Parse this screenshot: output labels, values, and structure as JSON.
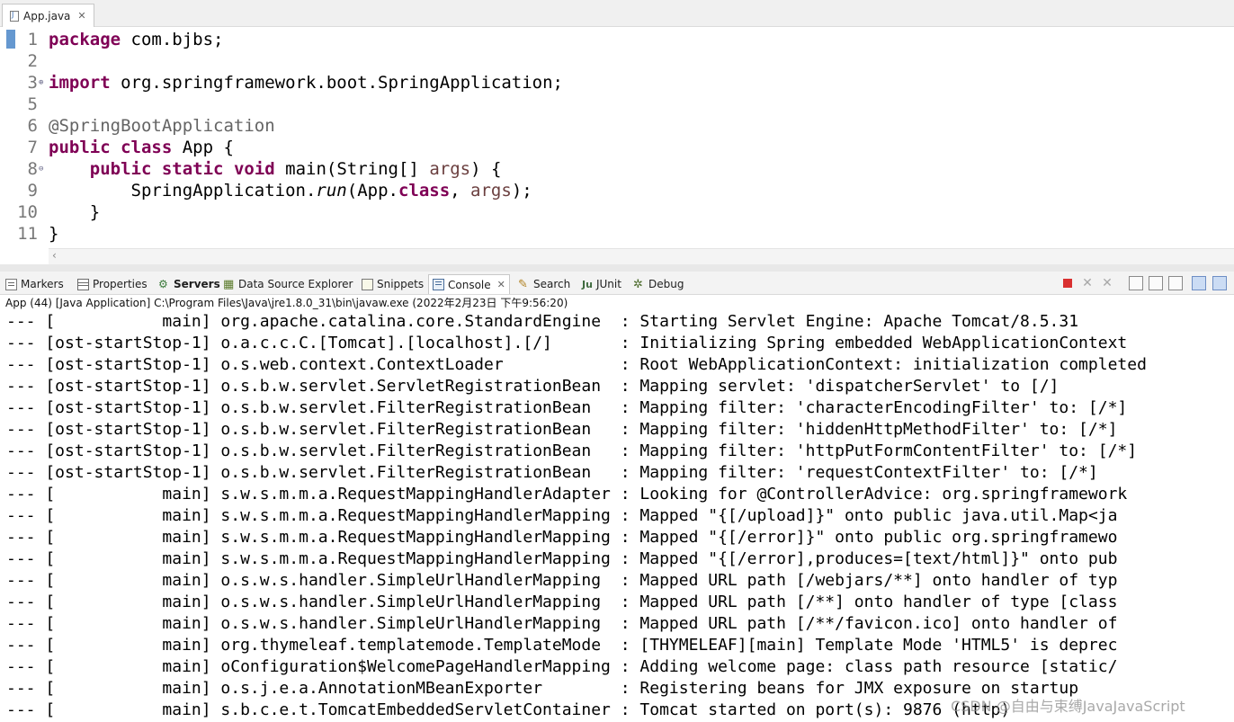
{
  "editor": {
    "tab_title": "App.java",
    "line_numbers": [
      "1",
      "2",
      "3",
      "5",
      "6",
      "7",
      "8",
      "9",
      "10",
      "11"
    ],
    "code_lines": [
      [
        {
          "t": "package",
          "c": "kw"
        },
        {
          "t": " com.bjbs;"
        }
      ],
      [],
      [
        {
          "t": "import",
          "c": "kw"
        },
        {
          "t": " org.springframework.boot.SpringApplication;"
        }
      ],
      [],
      [
        {
          "t": "@SpringBootApplication",
          "c": "ann"
        }
      ],
      [
        {
          "t": "public",
          "c": "kw"
        },
        {
          "t": " "
        },
        {
          "t": "class",
          "c": "kw"
        },
        {
          "t": " App {"
        }
      ],
      [
        {
          "t": "    "
        },
        {
          "t": "public",
          "c": "kw"
        },
        {
          "t": " "
        },
        {
          "t": "static",
          "c": "kw"
        },
        {
          "t": " "
        },
        {
          "t": "void",
          "c": "kw"
        },
        {
          "t": " main(String[] "
        },
        {
          "t": "args",
          "c": "var"
        },
        {
          "t": ") {"
        }
      ],
      [
        {
          "t": "        SpringApplication."
        },
        {
          "t": "run",
          "c": "it"
        },
        {
          "t": "(App."
        },
        {
          "t": "class",
          "c": "kw"
        },
        {
          "t": ", "
        },
        {
          "t": "args",
          "c": "var"
        },
        {
          "t": ");"
        }
      ],
      [
        {
          "t": "    }"
        }
      ],
      [
        {
          "t": "}"
        }
      ]
    ]
  },
  "views": {
    "tabs": [
      "Markers",
      "Properties",
      "Servers",
      "Data Source Explorer",
      "Snippets",
      "Console",
      "Search",
      "JUnit",
      "Debug"
    ],
    "active_tab": "Console",
    "toolbar_icons": [
      "terminate-icon",
      "remove-launch-icon",
      "remove-all-terminated-icon",
      "clear-console-icon",
      "scroll-lock-icon",
      "word-wrap-icon",
      "show-console-on-output-icon",
      "show-console-on-error-icon"
    ]
  },
  "console": {
    "header": "App (44) [Java Application] C:\\Program Files\\Java\\jre1.8.0_31\\bin\\javaw.exe (2022年2月23日 下午9:56:20)",
    "lines": [
      "--- [           main] org.apache.catalina.core.StandardEngine  : Starting Servlet Engine: Apache Tomcat/8.5.31",
      "--- [ost-startStop-1] o.a.c.c.C.[Tomcat].[localhost].[/]       : Initializing Spring embedded WebApplicationContext",
      "--- [ost-startStop-1] o.s.web.context.ContextLoader            : Root WebApplicationContext: initialization completed",
      "--- [ost-startStop-1] o.s.b.w.servlet.ServletRegistrationBean  : Mapping servlet: 'dispatcherServlet' to [/]",
      "--- [ost-startStop-1] o.s.b.w.servlet.FilterRegistrationBean   : Mapping filter: 'characterEncodingFilter' to: [/*]",
      "--- [ost-startStop-1] o.s.b.w.servlet.FilterRegistrationBean   : Mapping filter: 'hiddenHttpMethodFilter' to: [/*]",
      "--- [ost-startStop-1] o.s.b.w.servlet.FilterRegistrationBean   : Mapping filter: 'httpPutFormContentFilter' to: [/*]",
      "--- [ost-startStop-1] o.s.b.w.servlet.FilterRegistrationBean   : Mapping filter: 'requestContextFilter' to: [/*]",
      "--- [           main] s.w.s.m.m.a.RequestMappingHandlerAdapter : Looking for @ControllerAdvice: org.springframework",
      "--- [           main] s.w.s.m.m.a.RequestMappingHandlerMapping : Mapped \"{[/upload]}\" onto public java.util.Map<ja",
      "--- [           main] s.w.s.m.m.a.RequestMappingHandlerMapping : Mapped \"{[/error]}\" onto public org.springframewo",
      "--- [           main] s.w.s.m.m.a.RequestMappingHandlerMapping : Mapped \"{[/error],produces=[text/html]}\" onto pub",
      "--- [           main] o.s.w.s.handler.SimpleUrlHandlerMapping  : Mapped URL path [/webjars/**] onto handler of typ",
      "--- [           main] o.s.w.s.handler.SimpleUrlHandlerMapping  : Mapped URL path [/**] onto handler of type [class",
      "--- [           main] o.s.w.s.handler.SimpleUrlHandlerMapping  : Mapped URL path [/**/favicon.ico] onto handler of",
      "--- [           main] org.thymeleaf.templatemode.TemplateMode  : [THYMELEAF][main] Template Mode 'HTML5' is deprec",
      "--- [           main] oConfiguration$WelcomePageHandlerMapping : Adding welcome page: class path resource [static/",
      "--- [           main] o.s.j.e.a.AnnotationMBeanExporter        : Registering beans for JMX exposure on startup",
      "--- [           main] s.b.c.e.t.TomcatEmbeddedServletContainer : Tomcat started on port(s): 9876 (http)"
    ]
  },
  "watermark": "CSDN @自由与束缚JavaJavaScript"
}
